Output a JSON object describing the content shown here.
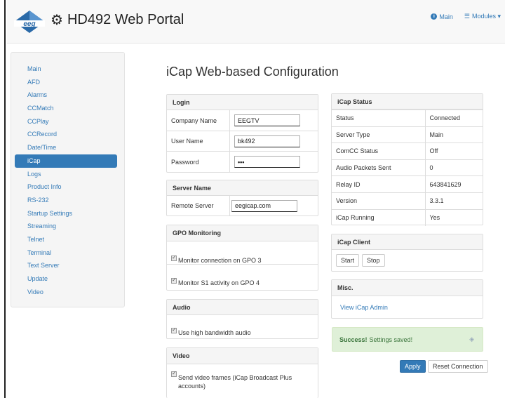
{
  "app": {
    "logo_text": "eeg",
    "title": "HD492 Web Portal"
  },
  "nav": {
    "main_label": "Main",
    "modules_label": "Modules ▾"
  },
  "sidebar": {
    "items": [
      {
        "label": "Main"
      },
      {
        "label": "AFD"
      },
      {
        "label": "Alarms"
      },
      {
        "label": "CCMatch"
      },
      {
        "label": "CCPlay"
      },
      {
        "label": "CCRecord"
      },
      {
        "label": "Date/Time"
      },
      {
        "label": "iCap"
      },
      {
        "label": "Logs"
      },
      {
        "label": "Product Info"
      },
      {
        "label": "RS-232"
      },
      {
        "label": "Startup Settings"
      },
      {
        "label": "Streaming"
      },
      {
        "label": "Telnet"
      },
      {
        "label": "Terminal"
      },
      {
        "label": "Text Server"
      },
      {
        "label": "Update"
      },
      {
        "label": "Video"
      }
    ],
    "active": "iCap"
  },
  "page_title": "iCap Web-based Configuration",
  "login": {
    "heading": "Login",
    "company_label": "Company Name",
    "company_value": "EEGTV",
    "user_label": "User Name",
    "user_value": "bk492",
    "password_label": "Password",
    "password_value": "•••"
  },
  "server": {
    "heading": "Server Name",
    "remote_label": "Remote Server",
    "remote_value": "eegicap.com"
  },
  "gpo": {
    "heading": "GPO Monitoring",
    "gpo3_label": "Monitor connection on GPO 3",
    "gpo4_label": "Monitor S1 activity on GPO 4"
  },
  "audio": {
    "heading": "Audio",
    "high_bw_label": "Use high bandwidth audio"
  },
  "video": {
    "heading": "Video",
    "send_frames_label": "Send video frames (iCap Broadcast Plus accounts)"
  },
  "status": {
    "heading": "iCap Status",
    "rows": [
      {
        "key": "Status",
        "value": "Connected"
      },
      {
        "key": "Server Type",
        "value": "Main"
      },
      {
        "key": "ComCC Status",
        "value": "Off"
      },
      {
        "key": "Audio Packets Sent",
        "value": "0"
      },
      {
        "key": "Relay ID",
        "value": "643841629"
      },
      {
        "key": "Version",
        "value": "3.3.1"
      },
      {
        "key": "iCap Running",
        "value": "Yes"
      }
    ]
  },
  "client": {
    "heading": "iCap Client",
    "start_label": "Start",
    "stop_label": "Stop"
  },
  "misc": {
    "heading": "Misc.",
    "admin_link": "View iCap Admin"
  },
  "alert": {
    "strong": "Success!",
    "text": "Settings saved!"
  },
  "actions": {
    "apply_label": "Apply",
    "reset_label": "Reset Connection"
  },
  "colors": {
    "accent": "#337ab7",
    "success_bg": "#dff0d8",
    "success_text": "#3c763d"
  }
}
